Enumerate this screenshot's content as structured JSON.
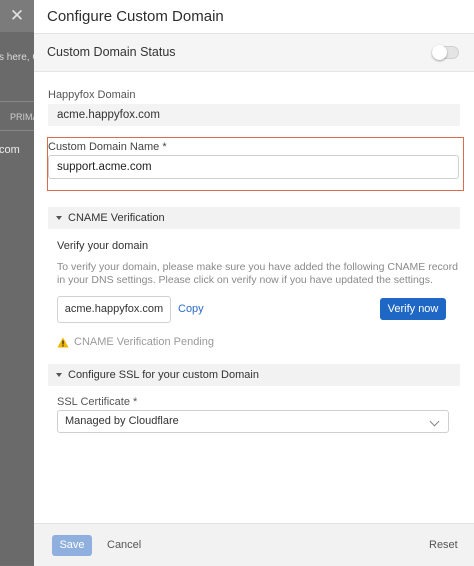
{
  "background": {
    "close_glyph": "✕",
    "hint_text": "s here, C",
    "column_header": "PRIMA",
    "row_text": "com"
  },
  "drawer": {
    "title": "Configure Custom Domain",
    "status": {
      "label": "Custom Domain Status",
      "enabled": false
    },
    "happyfox_domain": {
      "label": "Happyfox Domain",
      "value": "acme.happyfox.com"
    },
    "custom_domain": {
      "label": "Custom Domain Name *",
      "value": "support.acme.com"
    },
    "cname": {
      "header": "CNAME Verification",
      "title": "Verify your domain",
      "description": "To verify your domain, please make sure you have added the following CNAME record in your DNS settings. Please click on verify now if you have updated the settings.",
      "record_value": "acme.happyfox.com",
      "copy_label": "Copy",
      "verify_label": "Verify now",
      "status_text": "CNAME Verification Pending",
      "status_icon": "warning-icon"
    },
    "ssl": {
      "header": "Configure SSL for your custom Domain",
      "label": "SSL Certificate *",
      "selected": "Managed by Cloudflare"
    },
    "footer": {
      "save_label": "Save",
      "cancel_label": "Cancel",
      "reset_label": "Reset"
    }
  },
  "colors": {
    "accent": "#1f67c5",
    "save_disabled": "#8fb0de",
    "highlight_border": "#e06b4b",
    "warning": "#f2b600"
  }
}
